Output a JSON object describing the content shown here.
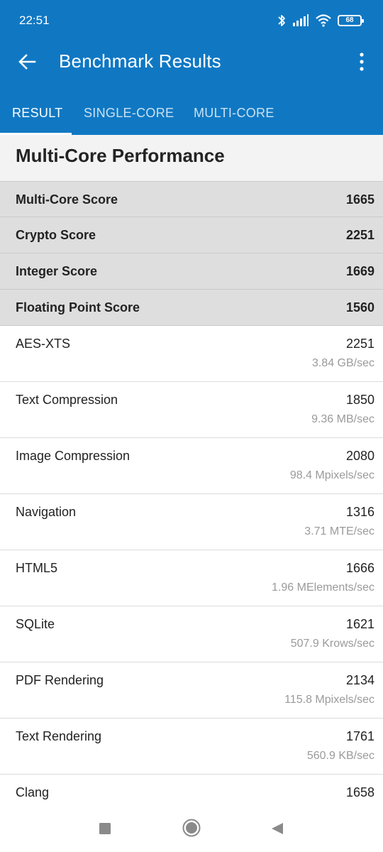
{
  "status_bar": {
    "time": "22:51",
    "battery": "68",
    "icons": [
      "bluetooth-icon",
      "signal-icon",
      "wifi-icon",
      "battery-icon"
    ]
  },
  "toolbar": {
    "title": "Benchmark Results",
    "back_icon": "arrow-left-icon",
    "more_icon": "more-vertical-icon"
  },
  "tabs": [
    {
      "label": "RESULT",
      "active": true
    },
    {
      "label": "SINGLE-CORE",
      "active": false
    },
    {
      "label": "MULTI-CORE",
      "active": false
    }
  ],
  "section": {
    "title": "Multi-Core Performance"
  },
  "summary": [
    {
      "label": "Multi-Core Score",
      "value": "1665"
    },
    {
      "label": "Crypto Score",
      "value": "2251"
    },
    {
      "label": "Integer Score",
      "value": "1669"
    },
    {
      "label": "Floating Point Score",
      "value": "1560"
    }
  ],
  "details": [
    {
      "label": "AES-XTS",
      "value": "2251",
      "sub": "3.84 GB/sec"
    },
    {
      "label": "Text Compression",
      "value": "1850",
      "sub": "9.36 MB/sec"
    },
    {
      "label": "Image Compression",
      "value": "2080",
      "sub": "98.4 Mpixels/sec"
    },
    {
      "label": "Navigation",
      "value": "1316",
      "sub": "3.71 MTE/sec"
    },
    {
      "label": "HTML5",
      "value": "1666",
      "sub": "1.96 MElements/sec"
    },
    {
      "label": "SQLite",
      "value": "1621",
      "sub": "507.9 Krows/sec"
    },
    {
      "label": "PDF Rendering",
      "value": "2134",
      "sub": "115.8 Mpixels/sec"
    },
    {
      "label": "Text Rendering",
      "value": "1761",
      "sub": "560.9 KB/sec"
    },
    {
      "label": "Clang",
      "value": "1658",
      "sub": ""
    }
  ],
  "nav_bar": {
    "icons": [
      "recents-square-icon",
      "home-circle-icon",
      "back-triangle-icon"
    ]
  },
  "colors": {
    "primary": "#1078c3",
    "summary_bg": "#dedede",
    "section_bg": "#f3f3f3",
    "muted_text": "#9a9a9a"
  }
}
